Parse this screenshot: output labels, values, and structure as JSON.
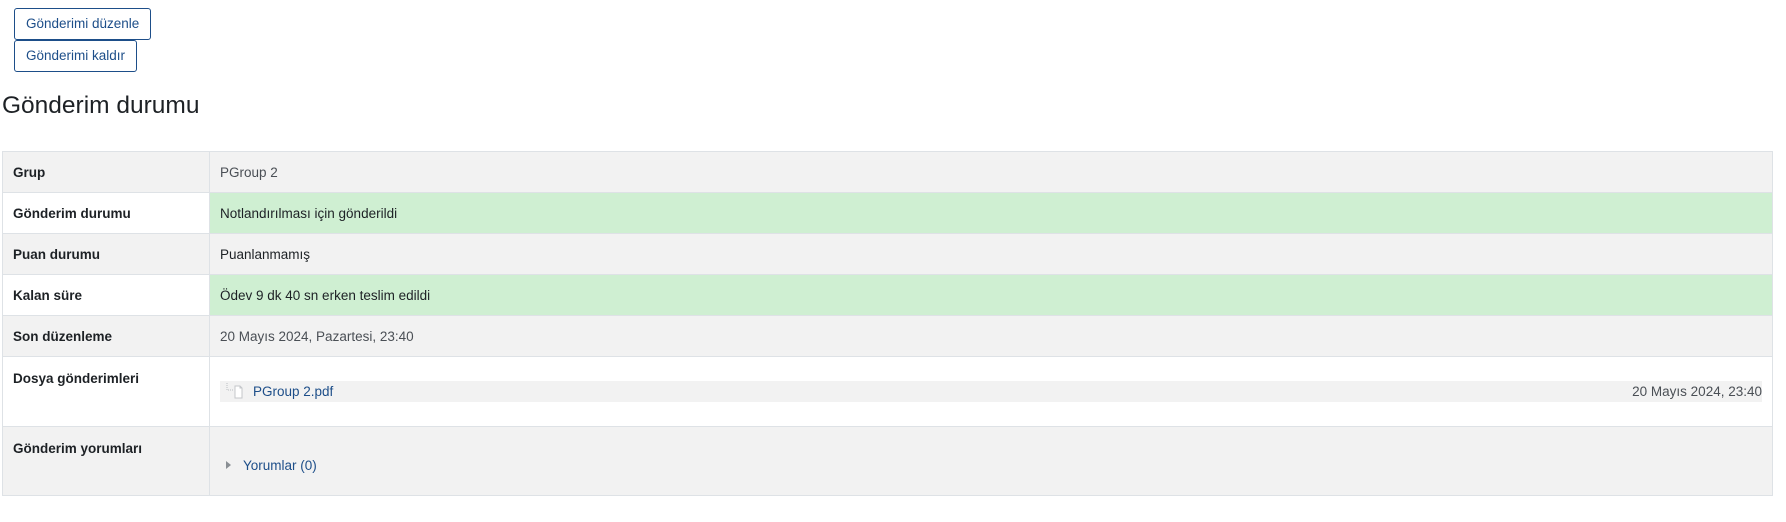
{
  "actions": {
    "edit_label": "Gönderimi düzenle",
    "remove_label": "Gönderimi kaldır"
  },
  "section": {
    "title": "Gönderim durumu"
  },
  "status_table": {
    "rows": [
      {
        "label": "Grup",
        "value": "PGroup 2"
      },
      {
        "label": "Gönderim durumu",
        "value": "Notlandırılması için gönderildi"
      },
      {
        "label": "Puan durumu",
        "value": "Puanlanmamış"
      },
      {
        "label": "Kalan süre",
        "value": "Ödev 9 dk 40 sn erken teslim edildi"
      },
      {
        "label": "Son düzenleme",
        "value": "20 Mayıs 2024, Pazartesi, 23:40"
      },
      {
        "label": "Dosya gönderimleri"
      },
      {
        "label": "Gönderim yorumları"
      }
    ],
    "file": {
      "name": "PGroup 2.pdf",
      "date": "20 Mayıs 2024, 23:40",
      "icon": "pdf-file-icon"
    },
    "comments": {
      "label": "Yorumlar (0)",
      "icon": "caret-right-icon"
    }
  },
  "colors": {
    "success_bg": "#cfefd2",
    "link": "#1d4e89",
    "stripe": "#f2f2f2"
  }
}
